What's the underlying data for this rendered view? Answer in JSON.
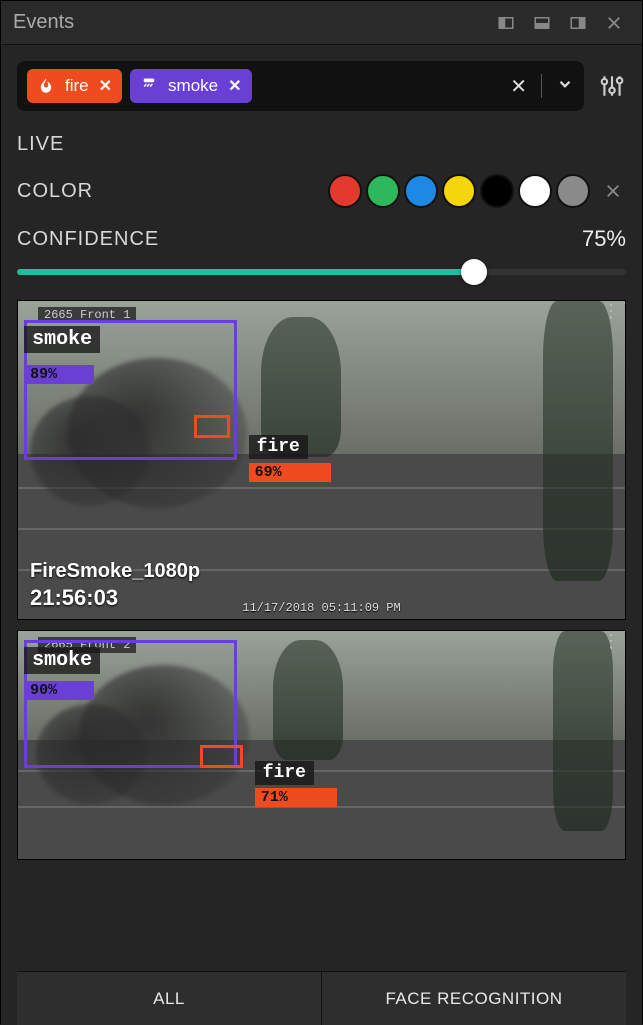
{
  "title": "Events",
  "tags": [
    {
      "label": "fire",
      "icon": "flame-icon",
      "color": "#f04b1e"
    },
    {
      "label": "smoke",
      "icon": "smoke-icon",
      "color": "#6a3fd6"
    }
  ],
  "controls": {
    "live_label": "LIVE",
    "color_label": "COLOR",
    "confidence_label": "CONFIDENCE",
    "confidence_value": "75%",
    "confidence_pct": 75
  },
  "colors": [
    "#e23b2e",
    "#2eb85c",
    "#1e88e5",
    "#f4d60a",
    "#000000",
    "#ffffff",
    "#8a8a8a"
  ],
  "feeds": [
    {
      "camera_id": "2665 Front 1",
      "name": "FireSmoke_1080p",
      "time": "21:56:03",
      "timestamp_overlay": "11/17/2018 05:11:09 PM",
      "detections": {
        "smoke": {
          "label": "smoke",
          "confidence": "89%"
        },
        "fire": {
          "label": "fire",
          "confidence": "69%"
        }
      }
    },
    {
      "camera_id": "2665 Front 2",
      "detections": {
        "smoke": {
          "label": "smoke",
          "confidence": "90%"
        },
        "fire": {
          "label": "fire",
          "confidence": "71%"
        }
      }
    }
  ],
  "tabs": {
    "all": "ALL",
    "face": "FACE RECOGNITION"
  }
}
